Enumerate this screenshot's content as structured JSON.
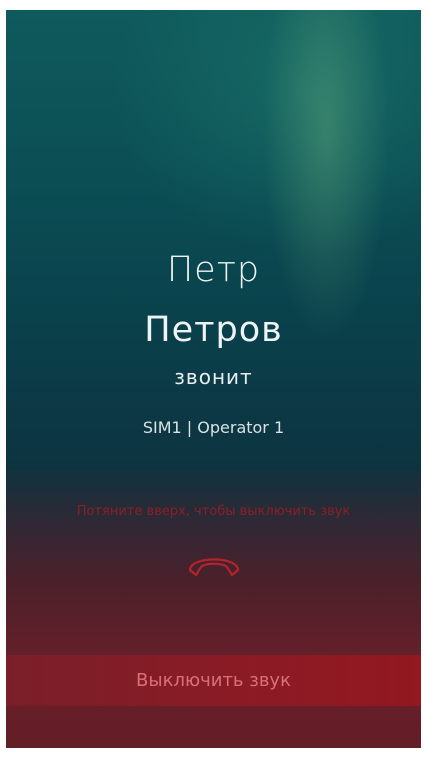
{
  "caller": {
    "first_name": "Петр",
    "last_name": "Петров",
    "status": "звонит"
  },
  "sim": {
    "info": "SIM1 | Operator 1"
  },
  "hint": {
    "text": "Потяните вверх, чтобы выключить звук"
  },
  "actions": {
    "mute_label": "Выключить звук",
    "decline_icon": "phone-hangup-icon"
  },
  "colors": {
    "background_top": "#0f5a5c",
    "background_bottom": "#4a2228",
    "accent_red": "#8c1f26",
    "mute_bar": "#8a1b25"
  }
}
